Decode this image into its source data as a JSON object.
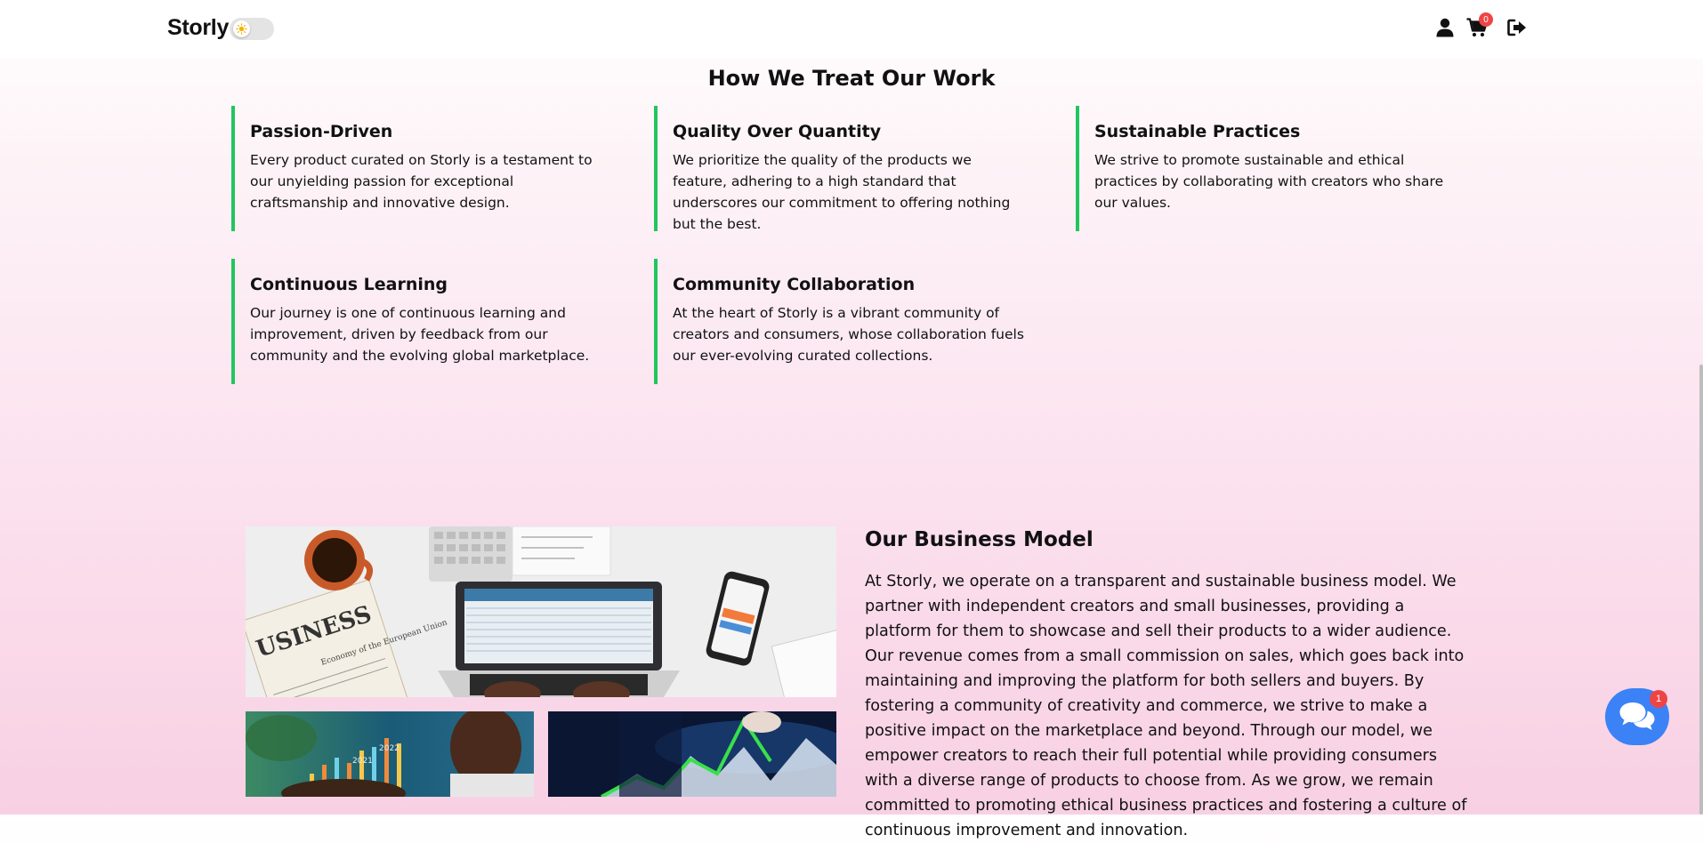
{
  "header": {
    "brand": "Storly",
    "cart_count": "0"
  },
  "values_section": {
    "title": "How We Treat Our Work",
    "cards": [
      {
        "title": "Passion-Driven",
        "desc": "Every product curated on Storly is a testament to our unyielding passion for exceptional craftsmanship and innovative design."
      },
      {
        "title": "Quality Over Quantity",
        "desc": "We prioritize the quality of the products we feature, adhering to a high standard that underscores our commitment to offering nothing but the best."
      },
      {
        "title": "Sustainable Practices",
        "desc": "We strive to promote sustainable and ethical practices by collaborating with creators who share our values."
      },
      {
        "title": "Continuous Learning",
        "desc": "Our journey is one of continuous learning and improvement, driven by feedback from our community and the evolving global marketplace."
      },
      {
        "title": "Community Collaboration",
        "desc": "At the heart of Storly is a vibrant community of creators and consumers, whose collaboration fuels our ever-evolving curated collections."
      }
    ]
  },
  "business_model": {
    "title": "Our Business Model",
    "text": "At Storly, we operate on a transparent and sustainable business model. We partner with independent creators and small businesses, providing a platform for them to showcase and sell their products to a wider audience. Our revenue comes from a small commission on sales, which goes back into maintaining and improving the platform for both sellers and buyers. By fostering a community of creativity and commerce, we strive to make a positive impact on the marketplace and beyond. Through our model, we empower creators to reach their full potential while providing consumers with a diverse range of products to choose from. As we grow, we remain committed to promoting ethical business practices and fostering a culture of continuous improvement and innovation.",
    "image_text": {
      "newspaper_masthead": "USINESS",
      "newspaper_headline": "Economy of the European Union",
      "chart_year_1": "2021",
      "chart_year_2": "2022"
    }
  },
  "chat_widget": {
    "badge": "1"
  },
  "colors": {
    "accent_green": "#22c55e",
    "chat_blue": "#3b82f6",
    "badge_red": "#ef4444"
  },
  "icons": {
    "theme_toggle": "sun-icon",
    "profile": "user-icon",
    "cart": "cart-icon",
    "logout": "logout-icon",
    "chat": "chat-bubbles-icon"
  }
}
